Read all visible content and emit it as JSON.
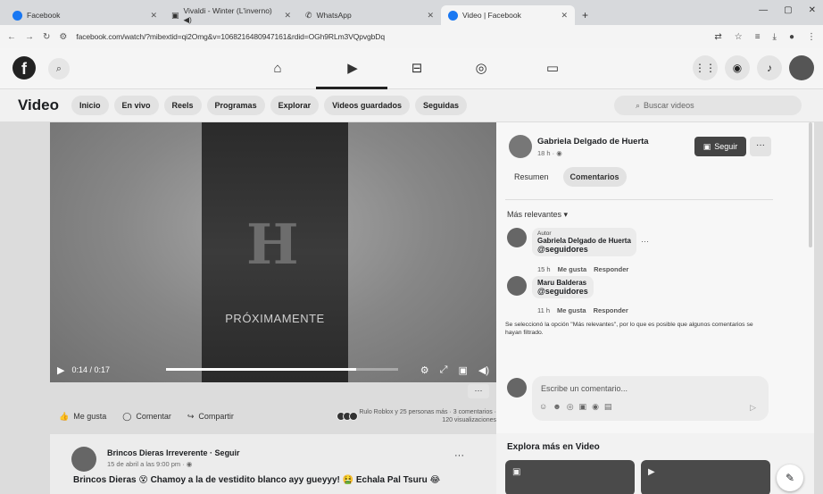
{
  "browser": {
    "tabs": [
      {
        "title": "Facebook",
        "active": false
      },
      {
        "title": "Vivaldi - Winter (L'inverno) ◀)",
        "active": false
      },
      {
        "title": "WhatsApp",
        "active": false
      },
      {
        "title": "Video | Facebook",
        "active": true
      }
    ],
    "new_tab": "+",
    "url": "facebook.com/watch/?mibextid=qi2Omg&v=1068216480947161&rdid=OGh9RLm3VQpvgbDq"
  },
  "fb": {
    "logo": "f",
    "section_title": "Video",
    "subnav": [
      "Inicio",
      "En vivo",
      "Reels",
      "Programas",
      "Explorar",
      "Videos guardados",
      "Seguidas"
    ],
    "search_placeholder": "Buscar videos"
  },
  "video": {
    "overlay_text": "PRÓXIMAMENTE",
    "time": "0:14 / 0:17",
    "progress": 0.82
  },
  "actions": {
    "like": "Me gusta",
    "comment": "Comentar",
    "share": "Compartir",
    "reactions_line1": "Rulo Roblox y 25 personas más · 3 comentarios ·",
    "reactions_line2": "120 visualizaciones",
    "more": "···"
  },
  "next_post": {
    "author": "Brincos Dieras Irreverente · Seguir",
    "time": "15 de abril a las 9:00 pm · ◉",
    "text": "Brincos Dieras 😵 Chamoy a la de vestidito blanco ayy gueyyy! 🤮 Echala Pal Tsuru 😂",
    "more": "···"
  },
  "panel": {
    "author": "Gabriela Delgado de Huerta",
    "time": "18 h · ◉",
    "follow": "Seguir",
    "more": "···",
    "tabs": [
      "Resumen",
      "Comentarios"
    ],
    "sort": "Más relevantes ▾",
    "comments": [
      {
        "tag": "Autor",
        "author": "Gabriela Delgado de Huerta",
        "text": "@seguidores",
        "time": "15 h",
        "like": "Me gusta",
        "reply": "Responder"
      },
      {
        "tag": "",
        "author": "Maru Balderas",
        "text": "@seguidores",
        "time": "11 h",
        "like": "Me gusta",
        "reply": "Responder"
      }
    ],
    "notice": "Se seleccionó la opción \"Más relevantes\", por lo que es posible que algunos comentarios se hayan filtrado.",
    "composer_placeholder": "Escribe un comentario...",
    "explore_title": "Explora más en Video"
  }
}
